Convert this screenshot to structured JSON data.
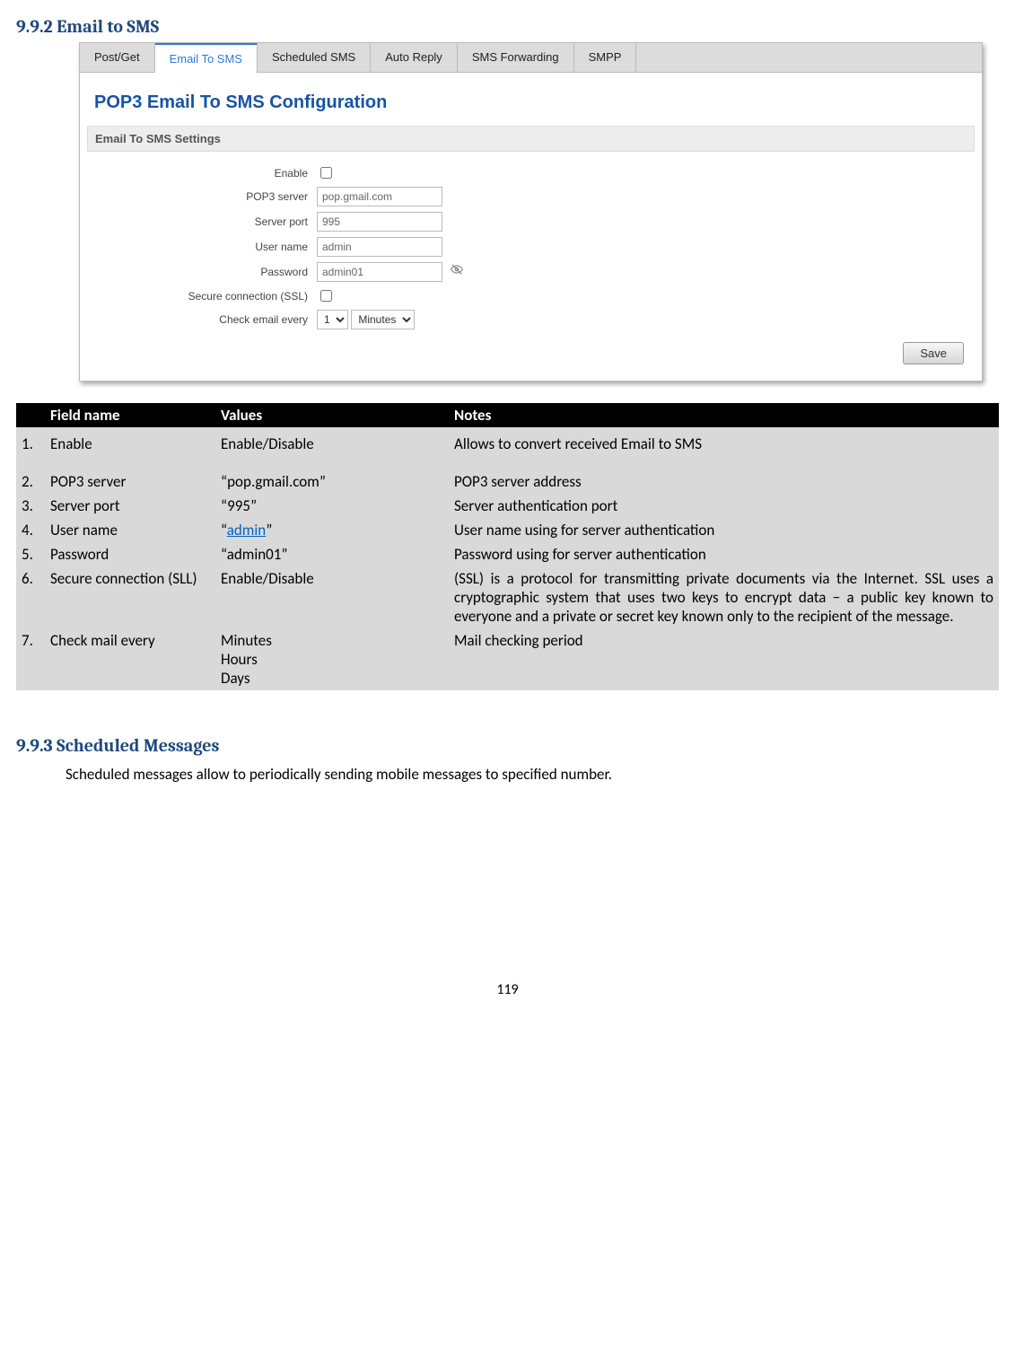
{
  "section1": {
    "number": "9.9.2",
    "title": "Email to SMS"
  },
  "section2": {
    "number": "9.9.3",
    "title": "Scheduled Messages"
  },
  "section2_para": "Scheduled messages allow to periodically sending mobile messages to specified number.",
  "page_number": "119",
  "shot": {
    "tabs": [
      {
        "label": "Post/Get",
        "active": false
      },
      {
        "label": "Email To SMS",
        "active": true
      },
      {
        "label": "Scheduled SMS",
        "active": false
      },
      {
        "label": "Auto Reply",
        "active": false
      },
      {
        "label": "SMS Forwarding",
        "active": false
      },
      {
        "label": "SMPP",
        "active": false
      }
    ],
    "panel_title": "POP3 Email To SMS Configuration",
    "settings_header": "Email To SMS Settings",
    "fields": {
      "enable": {
        "label": "Enable",
        "value": ""
      },
      "pop3": {
        "label": "POP3 server",
        "value": "pop.gmail.com"
      },
      "port": {
        "label": "Server port",
        "value": "995"
      },
      "user": {
        "label": "User name",
        "value": "admin"
      },
      "pass": {
        "label": "Password",
        "value": "admin01"
      },
      "ssl": {
        "label": "Secure connection (SSL)",
        "value": ""
      },
      "check": {
        "label": "Check email every",
        "num": "1",
        "unit": "Minutes"
      }
    },
    "save_label": "Save"
  },
  "desc_table": {
    "headers": {
      "num": "",
      "field": "Field name",
      "values": "Values",
      "notes": "Notes"
    },
    "rows": [
      {
        "n": "1.",
        "field": "Enable",
        "values": "Enable/Disable",
        "notes": "Allows to convert received Email to SMS",
        "tall": true
      },
      {
        "n": "2.",
        "field": "POP3 server",
        "values": "“pop.gmail.com”",
        "notes": "POP3 server address"
      },
      {
        "n": "3.",
        "field": "Server port",
        "values": "“995”",
        "notes": "Server authentication port"
      },
      {
        "n": "4.",
        "field": "User name",
        "values_pre": "“",
        "values_link": "admin",
        "values_post": "”",
        "notes": "User name using for server authentication"
      },
      {
        "n": "5.",
        "field": "Password",
        "values": "“admin01”",
        "notes": "Password using for server authentication"
      },
      {
        "n": "6.",
        "field": "Secure connection (SLL)",
        "values": "Enable/Disable",
        "notes": "(SSL) is a protocol for transmitting private documents via the Internet. SSL uses a cryptographic system that uses two keys to encrypt data − a public key known to everyone and a private or secret key known only to the recipient of the message."
      },
      {
        "n": "7.",
        "field": "Check mail every",
        "values": "Minutes\nHours\nDays",
        "notes": "Mail checking period"
      }
    ]
  }
}
